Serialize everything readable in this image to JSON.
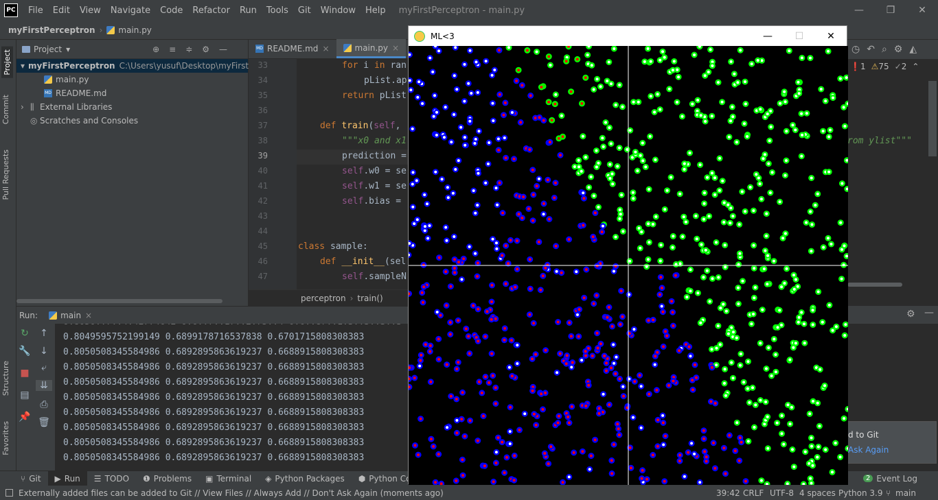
{
  "titlebar": {
    "app_icon": "PC",
    "menu": [
      "File",
      "Edit",
      "View",
      "Navigate",
      "Code",
      "Refactor",
      "Run",
      "Tools",
      "Git",
      "Window",
      "Help"
    ],
    "window_title": "myFirstPerceptron - main.py"
  },
  "navbar": {
    "project": "myFirstPerceptron",
    "file": "main.py"
  },
  "left_strip": {
    "project": "Project",
    "commit": "Commit",
    "pull_requests": "Pull Requests",
    "structure": "Structure",
    "favorites": "Favorites"
  },
  "project_panel": {
    "title": "Project",
    "root": "myFirstPerceptron",
    "root_path": "C:\\Users\\yusuf\\Desktop\\myFirstPerc",
    "files": [
      "main.py",
      "README.md"
    ],
    "external_libraries": "External Libraries",
    "scratches": "Scratches and Consoles"
  },
  "editor": {
    "tabs": [
      "README.md",
      "main.py"
    ],
    "breadcrumb": [
      "perceptron",
      "train()"
    ],
    "inspections": {
      "errors": "1",
      "warnings": "75",
      "weak": "2"
    },
    "right_fragment": "rom ylist\"\"\""
  },
  "run": {
    "label": "Run:",
    "config": "main",
    "lines": [
      "0.8049595752199149 0.6899178716537838 0.6701715808308383",
      "0.8050508345584986 0.6892895863619237 0.6688915808308383",
      "0.8050508345584986 0.6892895863619237 0.6688915808308383",
      "0.8050508345584986 0.6892895863619237 0.6688915808308383",
      "0.8050508345584986 0.6892895863619237 0.6688915808308383",
      "0.8050508345584986 0.6892895863619237 0.6688915808308383",
      "0.8050508345584986 0.6892895863619237 0.6688915808308383",
      "0.8050508345584986 0.6892895863619237 0.6688915808308383",
      "0.8050508345584986 0.6892895863619237 0.6688915808308383"
    ]
  },
  "bottom_tabs": [
    "Git",
    "Run",
    "TODO",
    "Problems",
    "Terminal",
    "Python Packages",
    "Python Consol",
    "Event Log"
  ],
  "event_log_count": "2",
  "status": {
    "message": "Externally added files can be added to Git // View Files // Always Add // Don't Ask Again (moments ago)",
    "position": "39:42",
    "line_sep": "CRLF",
    "encoding": "UTF-8",
    "indent": "4 spaces",
    "interpreter": "Python 3.9",
    "branch": "main"
  },
  "notification": {
    "line1": "d to Git",
    "link": "Ask Again"
  },
  "pygame_window": {
    "title": "ML<3",
    "colors": {
      "class_a_outer": "#00ff00",
      "class_b_outer": "#0000ff",
      "correct_center": "#ffffff",
      "wrong_center": "#ff0000",
      "axis": "#ffffff",
      "background": "#000000"
    }
  }
}
